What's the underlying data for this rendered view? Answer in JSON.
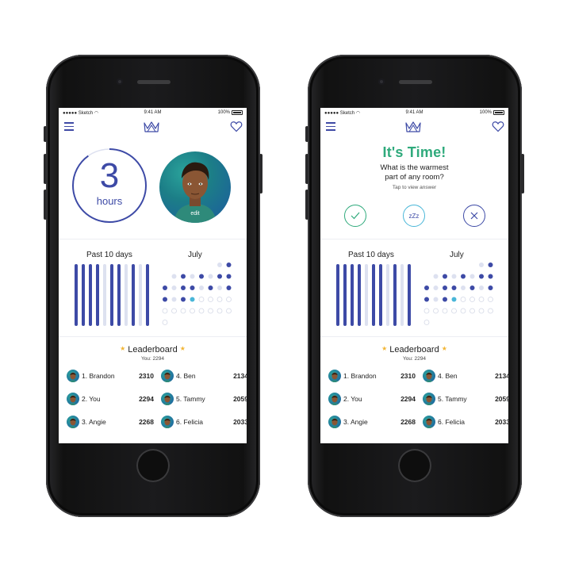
{
  "status_bar": {
    "carrier": "●●●●● Sketch ◠",
    "time": "9:41 AM",
    "battery": "100%"
  },
  "icons": {
    "menu": "hamburger-icon",
    "logo": "crown-icon",
    "favorite": "heart-icon"
  },
  "colors": {
    "accent": "#3d4aa6",
    "green": "#2faa7c",
    "light_blue": "#49b6d8",
    "bar_light": "#dde1f0",
    "star": "#f2b534"
  },
  "left_screen": {
    "timer": {
      "value": "3",
      "unit": "hours",
      "progress": 0.9
    },
    "avatar": {
      "edit_label": "edit"
    }
  },
  "right_screen": {
    "question": {
      "title": "It's Time!",
      "line1": "What is the warmest",
      "line2": "part of any room?",
      "hint": "Tap to view answer",
      "snooze_label": "zZz"
    }
  },
  "stats": {
    "past_label": "Past 10 days",
    "month_label": "July",
    "past_days": [
      1,
      1,
      1,
      1,
      0,
      1,
      1,
      0,
      1,
      0,
      1
    ],
    "calendar": [
      [
        "",
        "",
        "",
        "",
        "",
        "",
        "l",
        "d"
      ],
      [
        "",
        "l",
        "d",
        "l",
        "d",
        "l",
        "d",
        "d"
      ],
      [
        "d",
        "l",
        "d",
        "d",
        "l",
        "d",
        "l",
        "d"
      ],
      [
        "d",
        "l",
        "d",
        "c",
        "o",
        "o",
        "o",
        "o"
      ],
      [
        "o",
        "o",
        "o",
        "o",
        "o",
        "o",
        "o",
        "o"
      ],
      [
        "o",
        "",
        "",
        "",
        "",
        "",
        "",
        ""
      ]
    ]
  },
  "leaderboard": {
    "title": "Leaderboard",
    "subtitle": "You: 2294",
    "entries": [
      {
        "name": "1. Brandon",
        "score": "2310"
      },
      {
        "name": "4. Ben",
        "score": "2134"
      },
      {
        "name": "2. You",
        "score": "2294"
      },
      {
        "name": "5. Tammy",
        "score": "2059"
      },
      {
        "name": "3. Angie",
        "score": "2268"
      },
      {
        "name": "6. Felicia",
        "score": "2033"
      }
    ]
  }
}
